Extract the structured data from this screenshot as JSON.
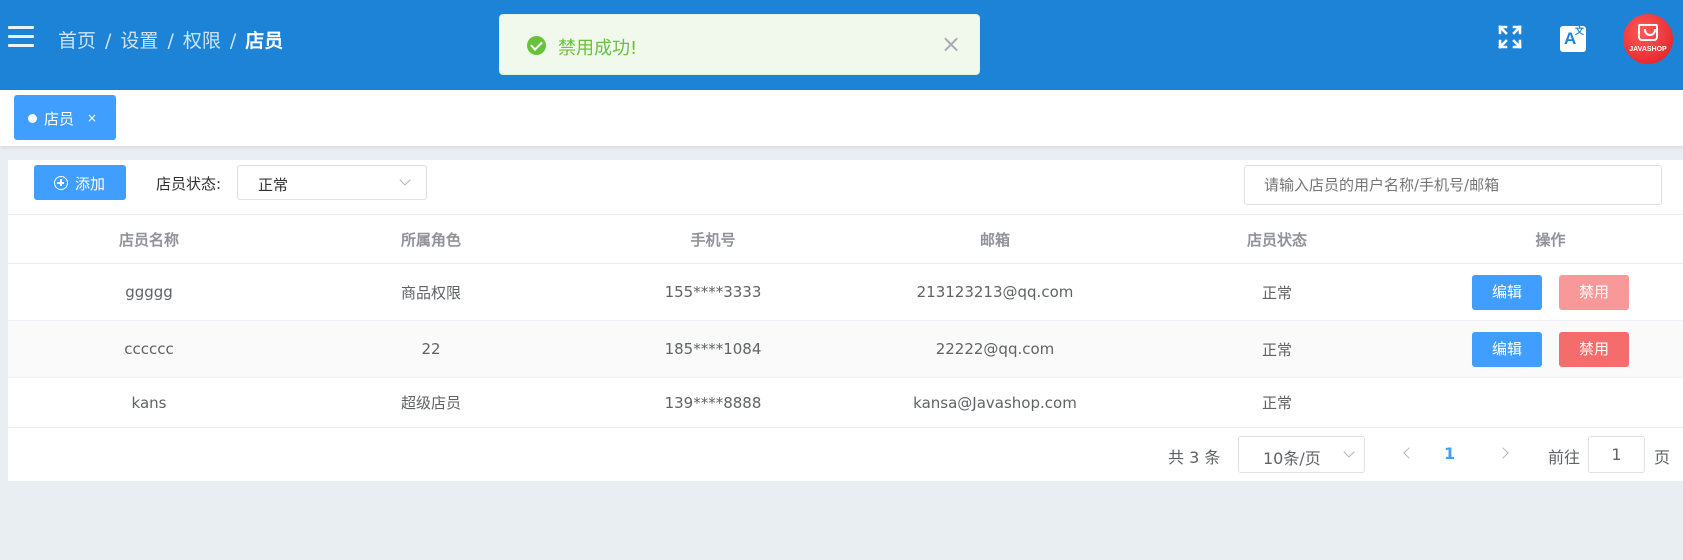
{
  "header": {
    "breadcrumb": [
      "首页",
      "设置",
      "权限"
    ],
    "breadcrumb_separator": "/",
    "breadcrumb_current": "店员",
    "lang_icon_letter": "A",
    "lang_icon_sub": "文",
    "avatar_brand": "JAVASHOP",
    "bg_color": "#1c83d6"
  },
  "toast": {
    "message": "禁用成功!",
    "close_glyph": "×",
    "type": "success"
  },
  "tags": [
    {
      "label": "店员",
      "close": "×"
    }
  ],
  "toolbar": {
    "add_label": "添加",
    "status_label": "店员状态:",
    "status_value": "正常",
    "search_placeholder": "请输入店员的用户名称/手机号/邮箱"
  },
  "table": {
    "columns": [
      "店员名称",
      "所属角色",
      "手机号",
      "邮箱",
      "店员状态",
      "操作"
    ],
    "rows": [
      {
        "name": "ggggg",
        "role": "商品权限",
        "phone": "155****3333",
        "email": "213123213@qq.com",
        "status": "正常",
        "edit": "编辑",
        "disable": "禁用"
      },
      {
        "name": "cccccc",
        "role": "22",
        "phone": "185****1084",
        "email": "22222@qq.com",
        "status": "正常",
        "edit": "编辑",
        "disable": "禁用"
      },
      {
        "name": "kans",
        "role": "超级店员",
        "phone": "139****8888",
        "email": "kansa@Javashop.com",
        "status": "正常"
      }
    ]
  },
  "pagination": {
    "total": "共 3 条",
    "page_size": "10条/页",
    "current_page": "1",
    "goto_label": "前往",
    "goto_value": "1",
    "page_unit": "页"
  },
  "colors": {
    "primary": "#409eff",
    "danger": "#f56c6c",
    "success": "#67c23a"
  }
}
